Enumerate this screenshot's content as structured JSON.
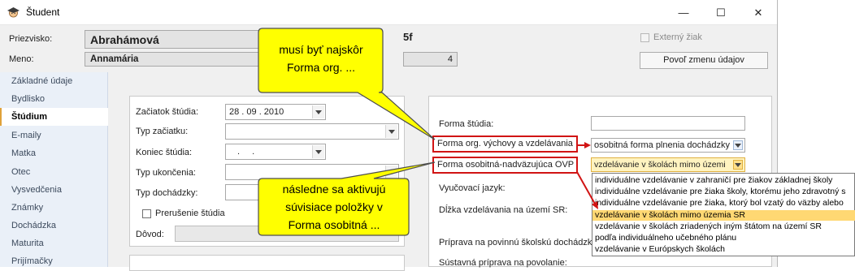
{
  "window": {
    "title": "Študent",
    "minimize": "—",
    "maximize": "☐",
    "close": "✕"
  },
  "header": {
    "surname_label": "Priezvisko:",
    "surname_value": "Abrahámová",
    "name_label": "Meno:",
    "name_value": "Annamária",
    "class_value": "5f",
    "number_value": "4",
    "external_label": "Externý žiak",
    "allow_button": "Povoľ zmenu údajov"
  },
  "sidebar": {
    "items": [
      {
        "label": "Základné údaje"
      },
      {
        "label": "Bydlisko"
      },
      {
        "label": "Štúdium"
      },
      {
        "label": "E-maily"
      },
      {
        "label": "Matka"
      },
      {
        "label": "Otec"
      },
      {
        "label": "Vysvedčenia"
      },
      {
        "label": "Známky"
      },
      {
        "label": "Dochádzka"
      },
      {
        "label": "Maturita"
      },
      {
        "label": "Prijímačky"
      }
    ],
    "active_index": 2
  },
  "left_group": {
    "start_label": "Začiatok štúdia:",
    "start_value": "28 . 09 . 2010",
    "start_type_label": "Typ začiatku:",
    "end_label": "Koniec štúdia:",
    "end_value": ".   .",
    "end_type_label": "Typ ukončenia:",
    "attendance_label": "Typ dochádzky:",
    "interruption_label": "Prerušenie štúdia",
    "reason_label": "Dôvod:"
  },
  "right_group": {
    "study_form_label": "Forma štúdia:",
    "org_form_label": "Forma org. výchovy a vzdelávania",
    "org_form_value": "osobitná forma plnenia dochádzky",
    "special_form_label": "Forma osobitná-nadväzujúca OVP",
    "special_form_value": "vzdelávanie v školách mimo územi",
    "language_label": "Vyučovací jazyk:",
    "duration_label": "Dĺžka vzdelávania na území SR:",
    "prep_label": "Príprava na povinnú školskú dochádzk",
    "system_prep_label": "Sústavná príprava na povolanie:"
  },
  "dropdown_options": [
    "individuálne vzdelávanie v zahraničí pre žiakov základnej školy",
    "individuálne vzdelávanie pre žiaka školy, ktorému jeho zdravotný s",
    "individuálne vzdelávanie pre žiaka, ktorý bol vzatý do väzby alebo",
    "vzdelávanie v školách mimo územia SR",
    "vzdelávanie v školách zriadených iným štátom na území SR",
    "podľa individuálneho učebného plánu",
    "vzdelávanie v Európskych školách"
  ],
  "dropdown_selected_index": 3,
  "callouts": {
    "first_line1": "musí byť najskôr",
    "first_line2": "Forma org. ...",
    "second_line1": "následne sa aktivujú",
    "second_line2": "súvisiace položky v",
    "second_line3": "Forma osobitná ..."
  },
  "colors": {
    "callout_fill": "#ffff00",
    "highlight_red": "#d11414",
    "selected_option": "#ffd873",
    "sidebar_bg": "#eaf0f8"
  }
}
